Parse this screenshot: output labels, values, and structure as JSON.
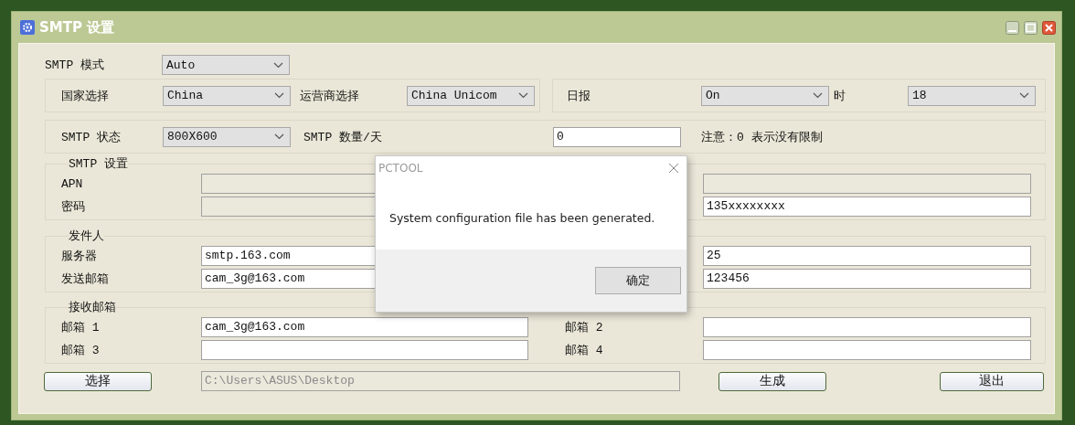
{
  "window": {
    "title": "SMTP 设置"
  },
  "mode": {
    "label": "SMTP 模式",
    "value": "Auto"
  },
  "country": {
    "label": "国家选择",
    "value": "China"
  },
  "carrier": {
    "label": "运营商选择",
    "value": "China Unicom"
  },
  "daily_report": {
    "label": "日报",
    "value": "On"
  },
  "hour": {
    "label": "时",
    "value": "18"
  },
  "status": {
    "label": "SMTP 状态",
    "value": "800X600"
  },
  "count_per_day": {
    "label": "SMTP 数量/天",
    "value": "0",
    "note": "注意：0 表示没有限制"
  },
  "groups": [
    {
      "title": "SMTP 设置",
      "rows": [
        {
          "left": {
            "label": "APN",
            "disabled": true
          },
          "right": {
            "disabled": true
          }
        },
        {
          "left": {
            "label": "密码",
            "disabled": true
          },
          "right": {
            "disabled": false,
            "value": "135xxxxxxxx"
          }
        }
      ]
    },
    {
      "title": "发件人",
      "rows": [
        {
          "left": {
            "label": "服务器",
            "disabled": false,
            "value": "smtp.163.com"
          },
          "right": {
            "disabled": false,
            "value": "25"
          }
        },
        {
          "left": {
            "label": "发送邮箱",
            "disabled": false,
            "value": "cam_3g@163.com"
          },
          "right": {
            "disabled": false,
            "value": "123456"
          }
        }
      ]
    },
    {
      "title": "接收邮箱",
      "rows": [
        {
          "left": {
            "label": "邮箱 1",
            "disabled": false,
            "value": "cam_3g@163.com"
          },
          "right": {
            "label": "邮箱 2",
            "disabled": false
          }
        },
        {
          "left": {
            "label": "邮箱 3",
            "disabled": false
          },
          "right": {
            "label": "邮箱 4",
            "disabled": false
          }
        }
      ]
    }
  ],
  "select_button": "选择",
  "path": {
    "value": "C:\\Users\\ASUS\\Desktop",
    "disabled": true
  },
  "generate_button": "生成",
  "exit_button": "退出",
  "dialog": {
    "title": "PCTOOL",
    "message": "System configuration file has been generated.",
    "ok_button": "确定"
  }
}
